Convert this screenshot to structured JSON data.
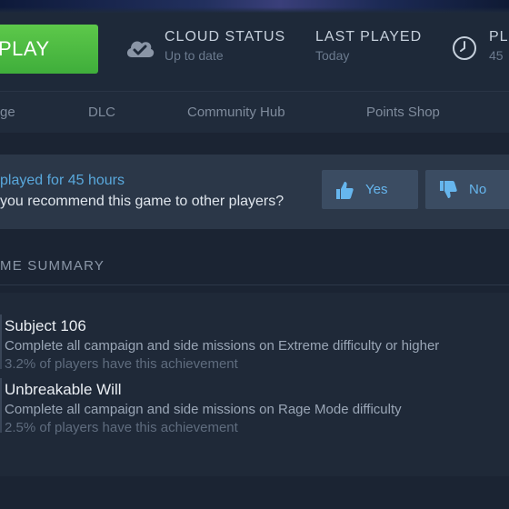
{
  "header": {
    "play_label": "PLAY",
    "cloud": {
      "label": "CLOUD STATUS",
      "value": "Up to date",
      "icon": "cloud-check-icon"
    },
    "last_played": {
      "label": "LAST PLAYED",
      "value": "Today"
    },
    "playtime": {
      "label": "PL",
      "value": "45",
      "icon": "clock-icon"
    }
  },
  "nav": {
    "items": [
      "ge",
      "DLC",
      "Community Hub",
      "Points Shop"
    ]
  },
  "review": {
    "played_text": "played for 45 hours",
    "question": "you recommend this game to other players?",
    "yes_label": "Yes",
    "no_label": "No"
  },
  "achievements": {
    "section_title": "ME SUMMARY",
    "items": [
      {
        "title": "Subject 106",
        "description": "Complete all campaign and side missions on Extreme difficulty or higher",
        "percent_text": "3.2% of players have this achievement"
      },
      {
        "title": "Unbreakable Will",
        "description": "Complete all campaign and side missions on Rage Mode difficulty",
        "percent_text": "2.5% of players have this achievement"
      }
    ]
  },
  "colors": {
    "play_green": "#4cbb43",
    "link_blue": "#59a8dc",
    "background": "#1b2433"
  }
}
